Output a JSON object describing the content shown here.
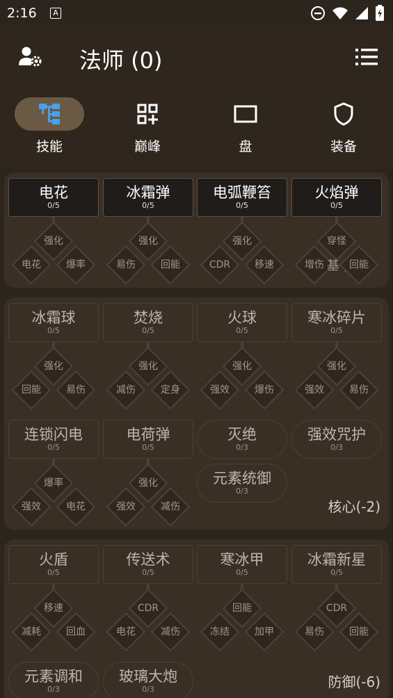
{
  "status": {
    "time": "2:16",
    "notif_glyph": "A"
  },
  "header": {
    "title": "法师 (0)",
    "profile_icon": "user-settings-icon",
    "menu_icon": "list-icon"
  },
  "tabs": [
    {
      "label": "技能",
      "icon": "skill-tree-icon",
      "active": true
    },
    {
      "label": "巅峰",
      "icon": "apps-add-icon"
    },
    {
      "label": "盘",
      "icon": "board-icon"
    },
    {
      "label": "装备",
      "icon": "shield-icon"
    }
  ],
  "g1": {
    "skills": [
      {
        "name": "电花",
        "count": "0/5",
        "mods": [
          "强化",
          "电花",
          "爆率"
        ]
      },
      {
        "name": "冰霜弹",
        "count": "0/5",
        "mods": [
          "强化",
          "易伤",
          "回能"
        ]
      },
      {
        "name": "电弧鞭笞",
        "count": "0/5",
        "mods": [
          "强化",
          "CDR",
          "移速"
        ]
      },
      {
        "name": "火焰弹",
        "count": "0/5",
        "mods": [
          "穿怪",
          "增伤",
          "回能"
        ]
      }
    ],
    "overflow": "基 )"
  },
  "g2": {
    "skills": [
      {
        "name": "冰霜球",
        "count": "0/5",
        "mods": [
          "强化",
          "回能",
          "易伤"
        ]
      },
      {
        "name": "焚烧",
        "count": "0/5",
        "mods": [
          "强化",
          "减伤",
          "定身"
        ]
      },
      {
        "name": "火球",
        "count": "0/5",
        "mods": [
          "强化",
          "强效",
          "爆伤"
        ]
      },
      {
        "name": "寒冰碎片",
        "count": "0/5",
        "mods": [
          "强化",
          "强效",
          "易伤"
        ]
      },
      {
        "name": "连锁闪电",
        "count": "0/5",
        "mods": [
          "爆率",
          "强效",
          "电花"
        ]
      },
      {
        "name": "电荷弹",
        "count": "0/5",
        "mods": [
          "强化",
          "强效",
          "减伤"
        ]
      }
    ],
    "ults": [
      {
        "name": "灭绝",
        "count": "0/3"
      },
      {
        "name": "强效咒护",
        "count": "0/3"
      },
      {
        "name": "元素统御",
        "count": "0/3"
      }
    ],
    "label": "核心(-2)"
  },
  "g3": {
    "skills": [
      {
        "name": "火盾",
        "count": "0/5",
        "mods": [
          "移速",
          "减耗",
          "回血"
        ]
      },
      {
        "name": "传送术",
        "count": "0/5",
        "mods": [
          "CDR",
          "电花",
          "减伤"
        ]
      },
      {
        "name": "寒冰甲",
        "count": "0/5",
        "mods": [
          "回能",
          "冻结",
          "加甲"
        ]
      },
      {
        "name": "冰霜新星",
        "count": "0/5",
        "mods": [
          "CDR",
          "易伤",
          "回能"
        ]
      }
    ],
    "ults": [
      {
        "name": "元素调和",
        "count": "0/3"
      },
      {
        "name": "玻璃大炮",
        "count": "0/3"
      }
    ],
    "label": "防御(-6)"
  }
}
